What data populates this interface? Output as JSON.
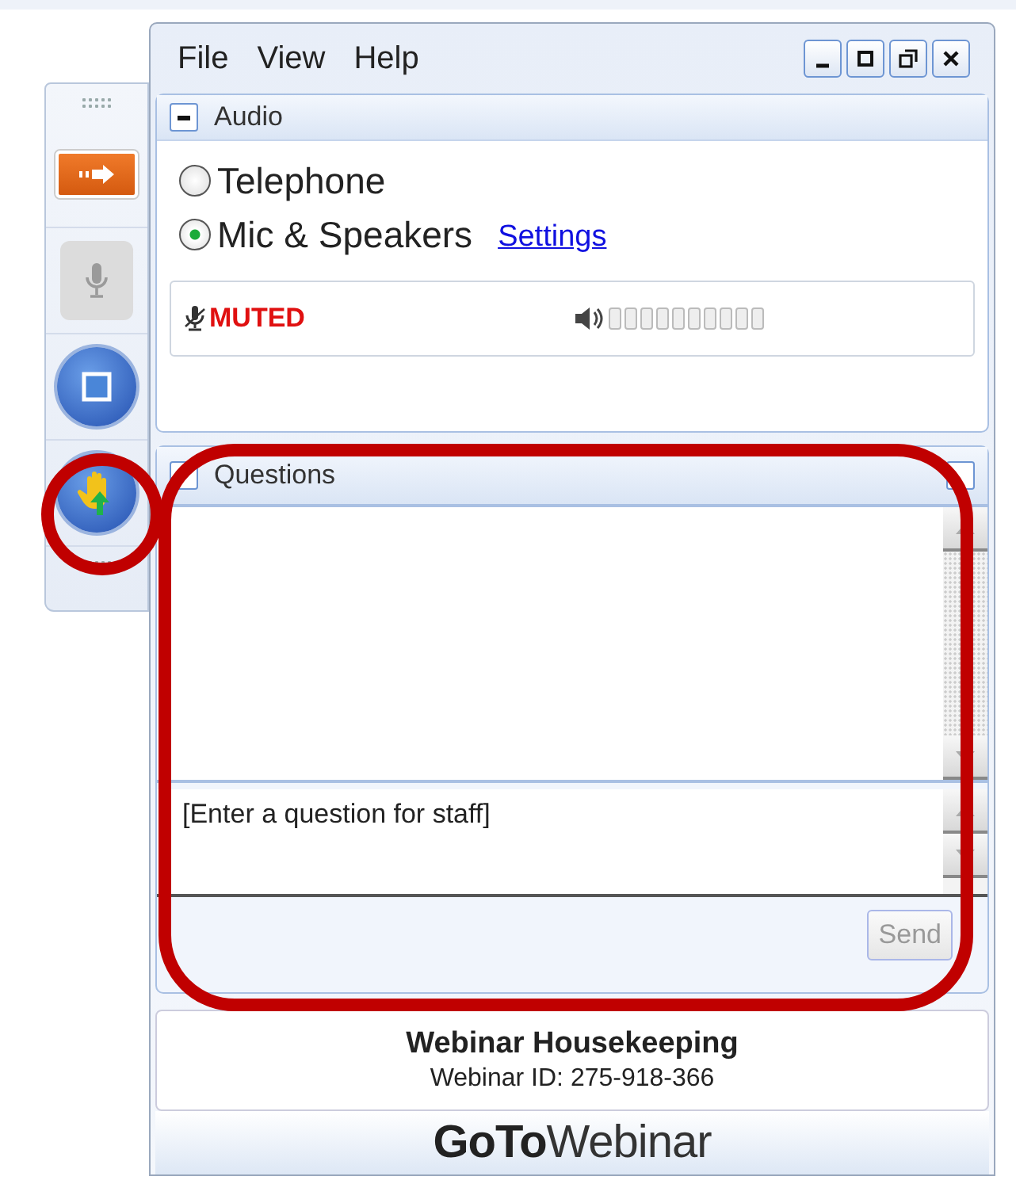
{
  "menu": [
    "File",
    "View",
    "Help"
  ],
  "window_controls": [
    {
      "kind": "minimize"
    },
    {
      "kind": "maximize"
    },
    {
      "kind": "restore"
    },
    {
      "kind": "close"
    }
  ],
  "side_toolbar": [
    {
      "kind": "arrow"
    },
    {
      "kind": "mic",
      "disabled": true
    },
    {
      "kind": "screen"
    },
    {
      "kind": "hand"
    }
  ],
  "audio": {
    "title": "Audio",
    "expanded": true,
    "options": [
      {
        "label": "Telephone",
        "selected": false
      },
      {
        "label": "Mic & Speakers",
        "selected": true
      }
    ],
    "settings_link": "Settings",
    "mic_status": "MUTED"
  },
  "questions": {
    "title": "Questions",
    "placeholder": "[Enter a question for staff]",
    "send": "Send"
  },
  "info": {
    "title": "Webinar Housekeeping",
    "webinar_id": "Webinar ID: 275-918-366"
  },
  "logo": {
    "bold": "GoTo",
    "light": "Webinar"
  },
  "annotations": [
    {
      "kind": "ring"
    },
    {
      "kind": "ring"
    }
  ]
}
